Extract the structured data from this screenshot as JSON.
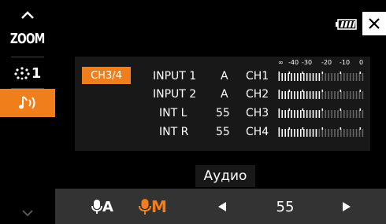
{
  "sidebar": {
    "zoom_label": "ZOOM",
    "scene_label": "1"
  },
  "battery": {
    "icon": "battery-icon"
  },
  "audio_panel": {
    "channel_badge": "CH3/4",
    "scale_labels": [
      "∞",
      "-40",
      "-30",
      "-20",
      "-10",
      "0"
    ],
    "rows": [
      {
        "input": "INPUT 1",
        "level": "A",
        "channel": "CH1",
        "meter_level": 0.5
      },
      {
        "input": "INPUT 2",
        "level": "A",
        "channel": "CH2",
        "meter_level": 0.5
      },
      {
        "input": "INT L",
        "level": "55",
        "channel": "CH3",
        "meter_level": 0.5
      },
      {
        "input": "INT R",
        "level": "55",
        "channel": "CH4",
        "meter_level": 0.45
      }
    ]
  },
  "mode_label": "Аудио",
  "bottom_bar": {
    "auto_mode": "A",
    "manual_mode": "M",
    "value": "55"
  },
  "colors": {
    "accent": "#f07e1b",
    "bar_bg": "#333333",
    "panel_bg": "#181818"
  }
}
